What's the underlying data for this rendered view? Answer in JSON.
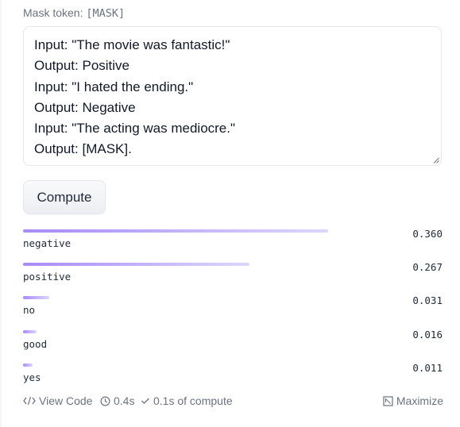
{
  "mask_token": {
    "label": "Mask token:",
    "value": "[MASK]"
  },
  "input": {
    "lines": [
      "Input: \"The movie was fantastic!\"",
      "Output: Positive",
      "Input: \"I hated the ending.\"",
      "Output: Negative",
      "Input: \"The acting was mediocre.\"",
      "Output: [MASK]."
    ]
  },
  "compute_label": "Compute",
  "results": [
    {
      "label": "negative",
      "score": "0.360",
      "fraction": 0.36
    },
    {
      "label": "positive",
      "score": "0.267",
      "fraction": 0.267
    },
    {
      "label": "no",
      "score": "0.031",
      "fraction": 0.031
    },
    {
      "label": "good",
      "score": "0.016",
      "fraction": 0.016
    },
    {
      "label": "yes",
      "score": "0.011",
      "fraction": 0.011
    }
  ],
  "footer": {
    "view_code": "View Code",
    "time": "0.4s",
    "compute_time": "0.1s of compute",
    "maximize": "Maximize"
  },
  "colors": {
    "bar_start": "#a78bfa",
    "bar_end": "#ddd6fe"
  },
  "icons": [
    "code-icon",
    "clock-icon",
    "check-icon",
    "maximize-icon"
  ]
}
